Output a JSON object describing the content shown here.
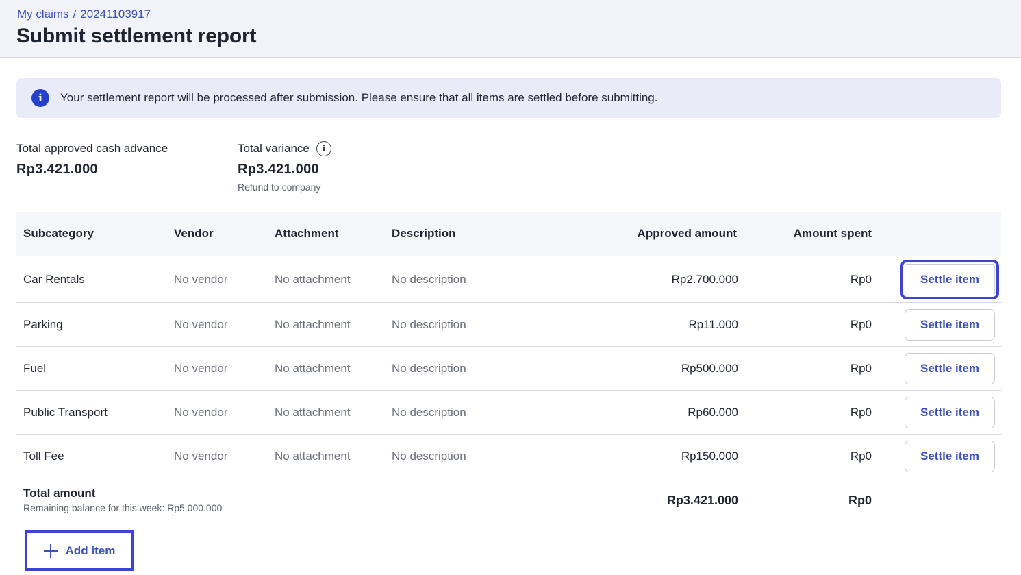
{
  "header": {
    "breadcrumb": [
      "My claims",
      "20241103917"
    ],
    "breadcrumb_separator": "/",
    "title": "Submit settlement report"
  },
  "banner": {
    "icon": "info-icon",
    "text": "Your settlement report will be processed after submission. Please ensure that all items are settled before submitting."
  },
  "summary": {
    "approved": {
      "label": "Total approved cash advance",
      "value": "Rp3.421.000"
    },
    "variance": {
      "label": "Total variance",
      "value": "Rp3.421.000",
      "note": "Refund to company",
      "icon": "info-circle-icon"
    }
  },
  "table": {
    "columns": [
      "Subcategory",
      "Vendor",
      "Attachment",
      "Description",
      "Approved amount",
      "Amount spent"
    ],
    "rows": [
      {
        "subcategory": "Car Rentals",
        "vendor": "No vendor",
        "attachment": "No attachment",
        "description": "No description",
        "approved": "Rp2.700.000",
        "spent": "Rp0",
        "action": "Settle item"
      },
      {
        "subcategory": "Parking",
        "vendor": "No vendor",
        "attachment": "No attachment",
        "description": "No description",
        "approved": "Rp11.000",
        "spent": "Rp0",
        "action": "Settle item"
      },
      {
        "subcategory": "Fuel",
        "vendor": "No vendor",
        "attachment": "No attachment",
        "description": "No description",
        "approved": "Rp500.000",
        "spent": "Rp0",
        "action": "Settle item"
      },
      {
        "subcategory": "Public Transport",
        "vendor": "No vendor",
        "attachment": "No attachment",
        "description": "No description",
        "approved": "Rp60.000",
        "spent": "Rp0",
        "action": "Settle item"
      },
      {
        "subcategory": "Toll Fee",
        "vendor": "No vendor",
        "attachment": "No attachment",
        "description": "No description",
        "approved": "Rp150.000",
        "spent": "Rp0",
        "action": "Settle item"
      }
    ],
    "total": {
      "label": "Total amount",
      "note": "Remaining balance for this week: Rp5.000.000",
      "approved": "Rp3.421.000",
      "spent": "Rp0"
    }
  },
  "add_item": {
    "label": "Add item",
    "icon": "plus-icon"
  },
  "colors": {
    "accent": "#3b4fc4",
    "highlight": "#3d45cf",
    "banner_bg": "#e9ebf8",
    "header_bg": "#f1f3f8"
  }
}
